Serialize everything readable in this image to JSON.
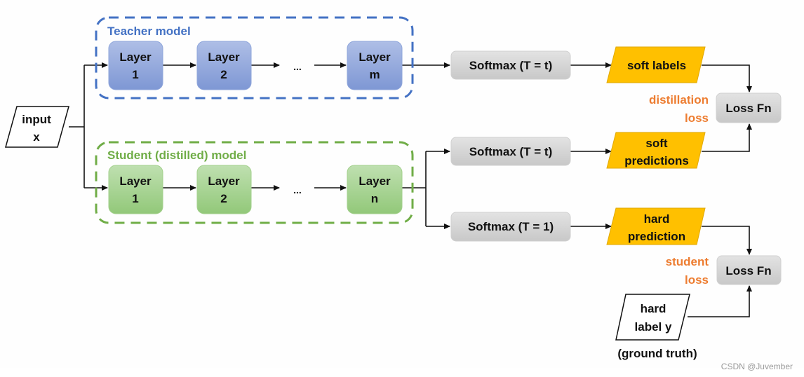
{
  "colors": {
    "teacher": "#4472C4",
    "student": "#70AD47",
    "output": "#FFC000",
    "loss_text": "#ED7D31",
    "softmax": "#D9D9D9"
  },
  "input": {
    "line1": "input",
    "line2": "x"
  },
  "teacher": {
    "title": "Teacher model",
    "layers": [
      {
        "l1": "Layer",
        "l2": "1"
      },
      {
        "l1": "Layer",
        "l2": "2"
      },
      {
        "l1": "Layer",
        "l2": "m"
      }
    ],
    "ellipsis": "..."
  },
  "student": {
    "title": "Student (distilled) model",
    "layers": [
      {
        "l1": "Layer",
        "l2": "1"
      },
      {
        "l1": "Layer",
        "l2": "2"
      },
      {
        "l1": "Layer",
        "l2": "n"
      }
    ],
    "ellipsis": "..."
  },
  "softmax": [
    "Softmax (T = t)",
    "Softmax (T = t)",
    "Softmax (T = 1)"
  ],
  "outputs": {
    "soft_labels": "soft labels",
    "soft_predictions": {
      "l1": "soft",
      "l2": "predictions"
    },
    "hard_prediction": {
      "l1": "hard",
      "l2": "prediction"
    }
  },
  "loss": {
    "fn1": "Loss Fn",
    "fn2": "Loss Fn",
    "distillation": {
      "l1": "distillation",
      "l2": "loss"
    },
    "student": {
      "l1": "student",
      "l2": "loss"
    }
  },
  "hard_label": {
    "l1": "hard",
    "l2": "label y",
    "caption": "(ground truth)"
  },
  "watermark": "CSDN @Juvember"
}
